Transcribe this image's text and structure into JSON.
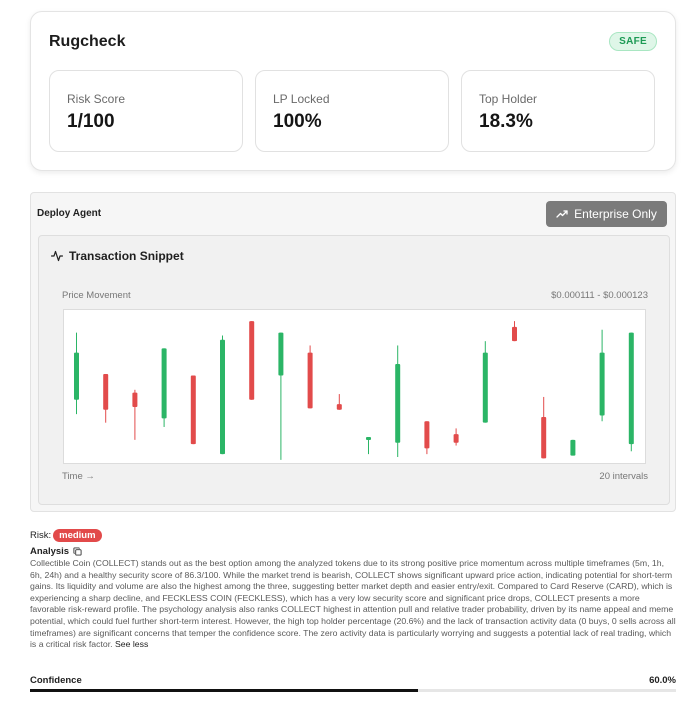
{
  "rugcheck": {
    "title": "Rugcheck",
    "badge": "SAFE",
    "stats": [
      {
        "label": "Risk Score",
        "value": "1/100"
      },
      {
        "label": "LP Locked",
        "value": "100%"
      },
      {
        "label": "Top Holder",
        "value": "18.3%"
      }
    ]
  },
  "deploy": {
    "label": "Deploy Agent",
    "enterprise_button": "Enterprise Only",
    "enterprise_icon": "trending-up-icon"
  },
  "snippet": {
    "title": "Transaction Snippet",
    "icon": "activity-icon",
    "price_label": "Price Movement",
    "price_range": "$0.000111 - $0.000123",
    "time_label": "Time →",
    "intervals_label": "20 intervals"
  },
  "colors": {
    "up": "#2bb566",
    "down": "#e24b4b"
  },
  "chart_data": {
    "type": "candlestick",
    "x_count": 20,
    "ylim": [
      0,
      100
    ],
    "candles": [
      {
        "dir": "up",
        "open": 40,
        "close": 73,
        "high": 87,
        "low": 30
      },
      {
        "dir": "down",
        "open": 58,
        "close": 33,
        "high": 58,
        "low": 24
      },
      {
        "dir": "down",
        "open": 45,
        "close": 35,
        "high": 47,
        "low": 12
      },
      {
        "dir": "up",
        "open": 27,
        "close": 76,
        "high": 76,
        "low": 21
      },
      {
        "dir": "down",
        "open": 57,
        "close": 9,
        "high": 57,
        "low": 9
      },
      {
        "dir": "up",
        "open": 2,
        "close": 82,
        "high": 85,
        "low": 2
      },
      {
        "dir": "down",
        "open": 95,
        "close": 40,
        "high": 95,
        "low": 40
      },
      {
        "dir": "up",
        "open": 57,
        "close": 87,
        "high": 87,
        "low": -2
      },
      {
        "dir": "down",
        "open": 73,
        "close": 34,
        "high": 78,
        "low": 34
      },
      {
        "dir": "down",
        "open": 37,
        "close": 33,
        "high": 44,
        "low": 33
      },
      {
        "dir": "up",
        "open": 14,
        "close": 14,
        "high": 14,
        "low": 2
      },
      {
        "dir": "up",
        "open": 10,
        "close": 65,
        "high": 78,
        "low": 0
      },
      {
        "dir": "down",
        "open": 25,
        "close": 6,
        "high": 25,
        "low": 2
      },
      {
        "dir": "down",
        "open": 16,
        "close": 10,
        "high": 20,
        "low": 8
      },
      {
        "dir": "up",
        "open": 24,
        "close": 73,
        "high": 81,
        "low": 24
      },
      {
        "dir": "down",
        "open": 91,
        "close": 81,
        "high": 95,
        "low": 81
      },
      {
        "dir": "down",
        "open": 28,
        "close": -1,
        "high": 42,
        "low": -1
      },
      {
        "dir": "up",
        "open": 1,
        "close": 12,
        "high": 12,
        "low": 1
      },
      {
        "dir": "up",
        "open": 29,
        "close": 73,
        "high": 89,
        "low": 25
      },
      {
        "dir": "up",
        "open": 9,
        "close": 87,
        "high": 87,
        "low": 4
      }
    ]
  },
  "analysis": {
    "risk_label": "Risk:",
    "risk_value": "medium",
    "heading": "Analysis",
    "text": "Collectible Coin (COLLECT) stands out as the best option among the analyzed tokens due to its strong positive price momentum across multiple timeframes (5m, 1h, 6h, 24h) and a healthy security score of 86.3/100. While the market trend is bearish, COLLECT shows significant upward price action, indicating potential for short-term gains. Its liquidity and volume are also the highest among the three, suggesting better market depth and easier entry/exit. Compared to Card Reserve (CARD), which is experiencing a sharp decline, and FECKLESS COIN (FECKLESS), which has a very low security score and significant price drops, COLLECT presents a more favorable risk-reward profile. The psychology analysis also ranks COLLECT highest in attention pull and relative trader probability, driven by its name appeal and meme potential, which could fuel further short-term interest. However, the high top holder percentage (20.6%) and the lack of transaction activity data (0 buys, 0 sells across all timeframes) are significant concerns that temper the confidence score. The zero activity data is particularly worrying and suggests a potential lack of real trading, which is a critical risk factor.",
    "see_less": "See less"
  },
  "confidence": {
    "label": "Confidence",
    "value_text": "60.0%",
    "fraction": 0.6
  }
}
